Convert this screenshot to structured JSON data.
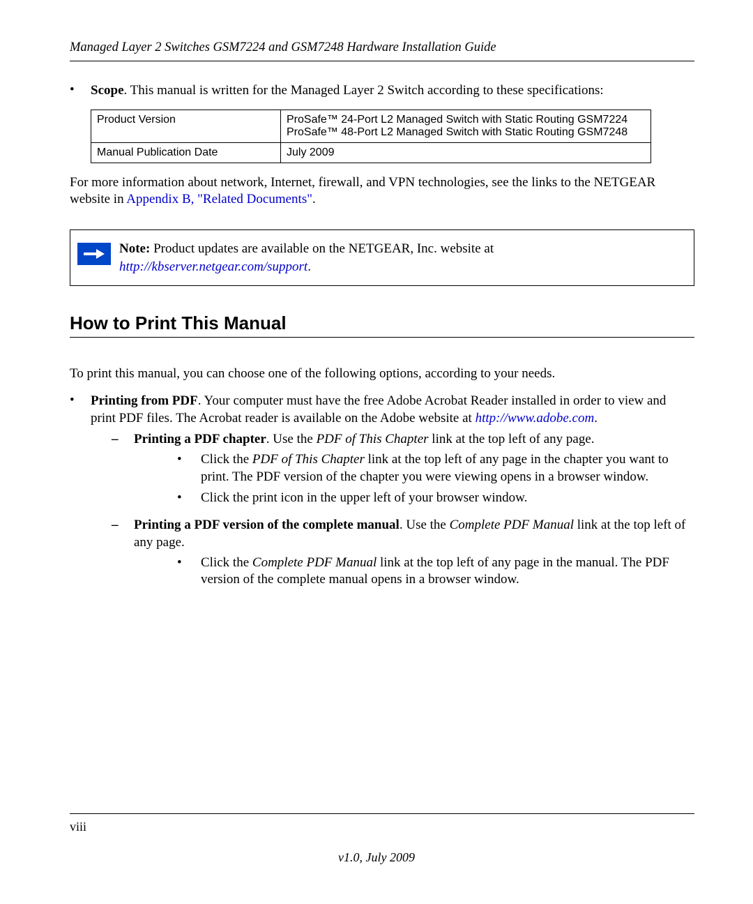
{
  "header": {
    "title": "Managed Layer 2 Switches GSM7224 and GSM7248 Hardware Installation Guide"
  },
  "scope": {
    "label": "Scope",
    "text": ". This manual is written for the Managed Layer 2 Switch according to these specifications:"
  },
  "spec_table": {
    "rows": [
      {
        "label": "Product Version",
        "lines": [
          "ProSafe™ 24-Port L2 Managed Switch with Static Routing GSM7224",
          "ProSafe™ 48-Port L2 Managed Switch with Static Routing GSM7248"
        ]
      },
      {
        "label": "Manual Publication Date",
        "lines": [
          "July 2009"
        ]
      }
    ]
  },
  "more_info": {
    "prefix": "For more information about network, Internet, firewall, and VPN technologies, see the links to the NETGEAR website in ",
    "link": "Appendix B, \"Related Documents\"",
    "suffix": "."
  },
  "note": {
    "label": "Note:",
    "text": " Product updates are available on the NETGEAR, Inc. website at ",
    "url": "http://kbserver.netgear.com/support",
    "suffix": "."
  },
  "section_heading": "How to Print This Manual",
  "print_intro": "To print this manual, you can choose one of the following options, according to your needs.",
  "pdf_bullet": {
    "label": "Printing from PDF",
    "text": ". Your computer must have the free Adobe Acrobat Reader installed in order to view and print PDF files. The Acrobat reader is available on the Adobe website at ",
    "url": "http://www.adobe.com",
    "suffix": "."
  },
  "pdf_chapter": {
    "label": "Printing a PDF chapter",
    "text1": ". Use the ",
    "italic1": "PDF of This Chapter",
    "text2": " link at the top left of any page."
  },
  "pdf_chapter_sub1": {
    "pre": "Click the ",
    "italic": "PDF of This Chapter",
    "post": " link at the top left of any page in the chapter you want to print. The PDF version of the chapter you were viewing opens in a browser window."
  },
  "pdf_chapter_sub2": "Click the print icon in the upper left of your browser window.",
  "pdf_complete": {
    "label": "Printing a PDF version of the complete manual",
    "text1": ". Use the ",
    "italic1": "Complete PDF Manual",
    "text2": " link at the top left of any page."
  },
  "pdf_complete_sub1": {
    "pre": "Click the ",
    "italic": "Complete PDF Manual",
    "post": " link at the top left of any page in the manual. The PDF version of the complete manual opens in a browser window."
  },
  "footer": {
    "page": "viii",
    "version": "v1.0, July 2009"
  }
}
